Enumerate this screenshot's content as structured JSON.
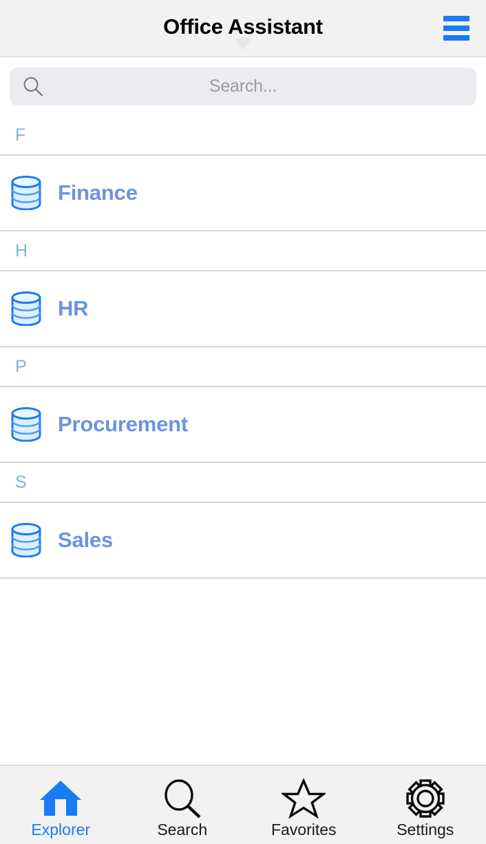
{
  "header": {
    "title": "Office Assistant",
    "menu_icon": "hamburger-menu-icon",
    "menu_color": "#1a7bf2"
  },
  "search": {
    "icon": "search-icon",
    "placeholder": "Search...",
    "value": ""
  },
  "list": {
    "sections": [
      {
        "letter": "F",
        "items": [
          {
            "label": "Finance",
            "icon": "database-icon"
          }
        ]
      },
      {
        "letter": "H",
        "items": [
          {
            "label": "HR",
            "icon": "database-icon"
          }
        ]
      },
      {
        "letter": "P",
        "items": [
          {
            "label": "Procurement",
            "icon": "database-icon"
          }
        ]
      },
      {
        "letter": "S",
        "items": [
          {
            "label": "Sales",
            "icon": "database-icon"
          }
        ]
      }
    ],
    "item_color": "#6d93e0",
    "section_letter_color": "#7fb4d4"
  },
  "tabbar": {
    "active_index": 0,
    "active_color": "#1a7bf2",
    "inactive_color": "#1a1a1a",
    "tabs": [
      {
        "label": "Explorer",
        "icon": "home-icon"
      },
      {
        "label": "Search",
        "icon": "search-icon"
      },
      {
        "label": "Favorites",
        "icon": "star-icon"
      },
      {
        "label": "Settings",
        "icon": "gear-icon"
      }
    ]
  }
}
